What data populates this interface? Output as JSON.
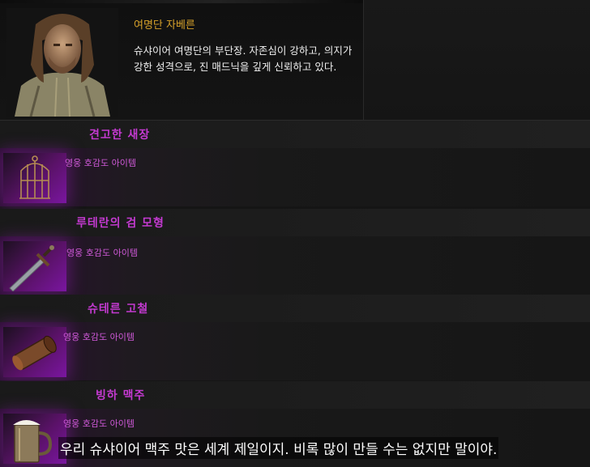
{
  "npc": {
    "name": "여명단 자베른",
    "description": "슈샤이어 여명단의 부단장. 자존심이 강하고, 의지가 강한 성격으로, 진 매드닉을 깊게 신뢰하고 있다."
  },
  "rewards": [
    {
      "title": "견고한 새장",
      "grade": "영웅 호감도 아이템",
      "icon": "birdcage-icon"
    },
    {
      "title": "루테란의 검 모형",
      "grade": "영웅 호감도 아이템",
      "icon": "sword-icon"
    },
    {
      "title": "슈테른 고철",
      "grade": "영웅 호감도 아이템",
      "icon": "scrap-pipe-icon"
    },
    {
      "title": "빙하 맥주",
      "grade": "영웅 호감도 아이템",
      "icon": "beer-mug-icon"
    }
  ],
  "subtitle": "우리 슈샤이어 맥주 맛은 세계 제일이지. 비록 많이 만들 수는 없지만 말이야.",
  "colors": {
    "name": "#d6a12a",
    "item_title": "#c43ad1",
    "grade": "#cf59d8"
  }
}
